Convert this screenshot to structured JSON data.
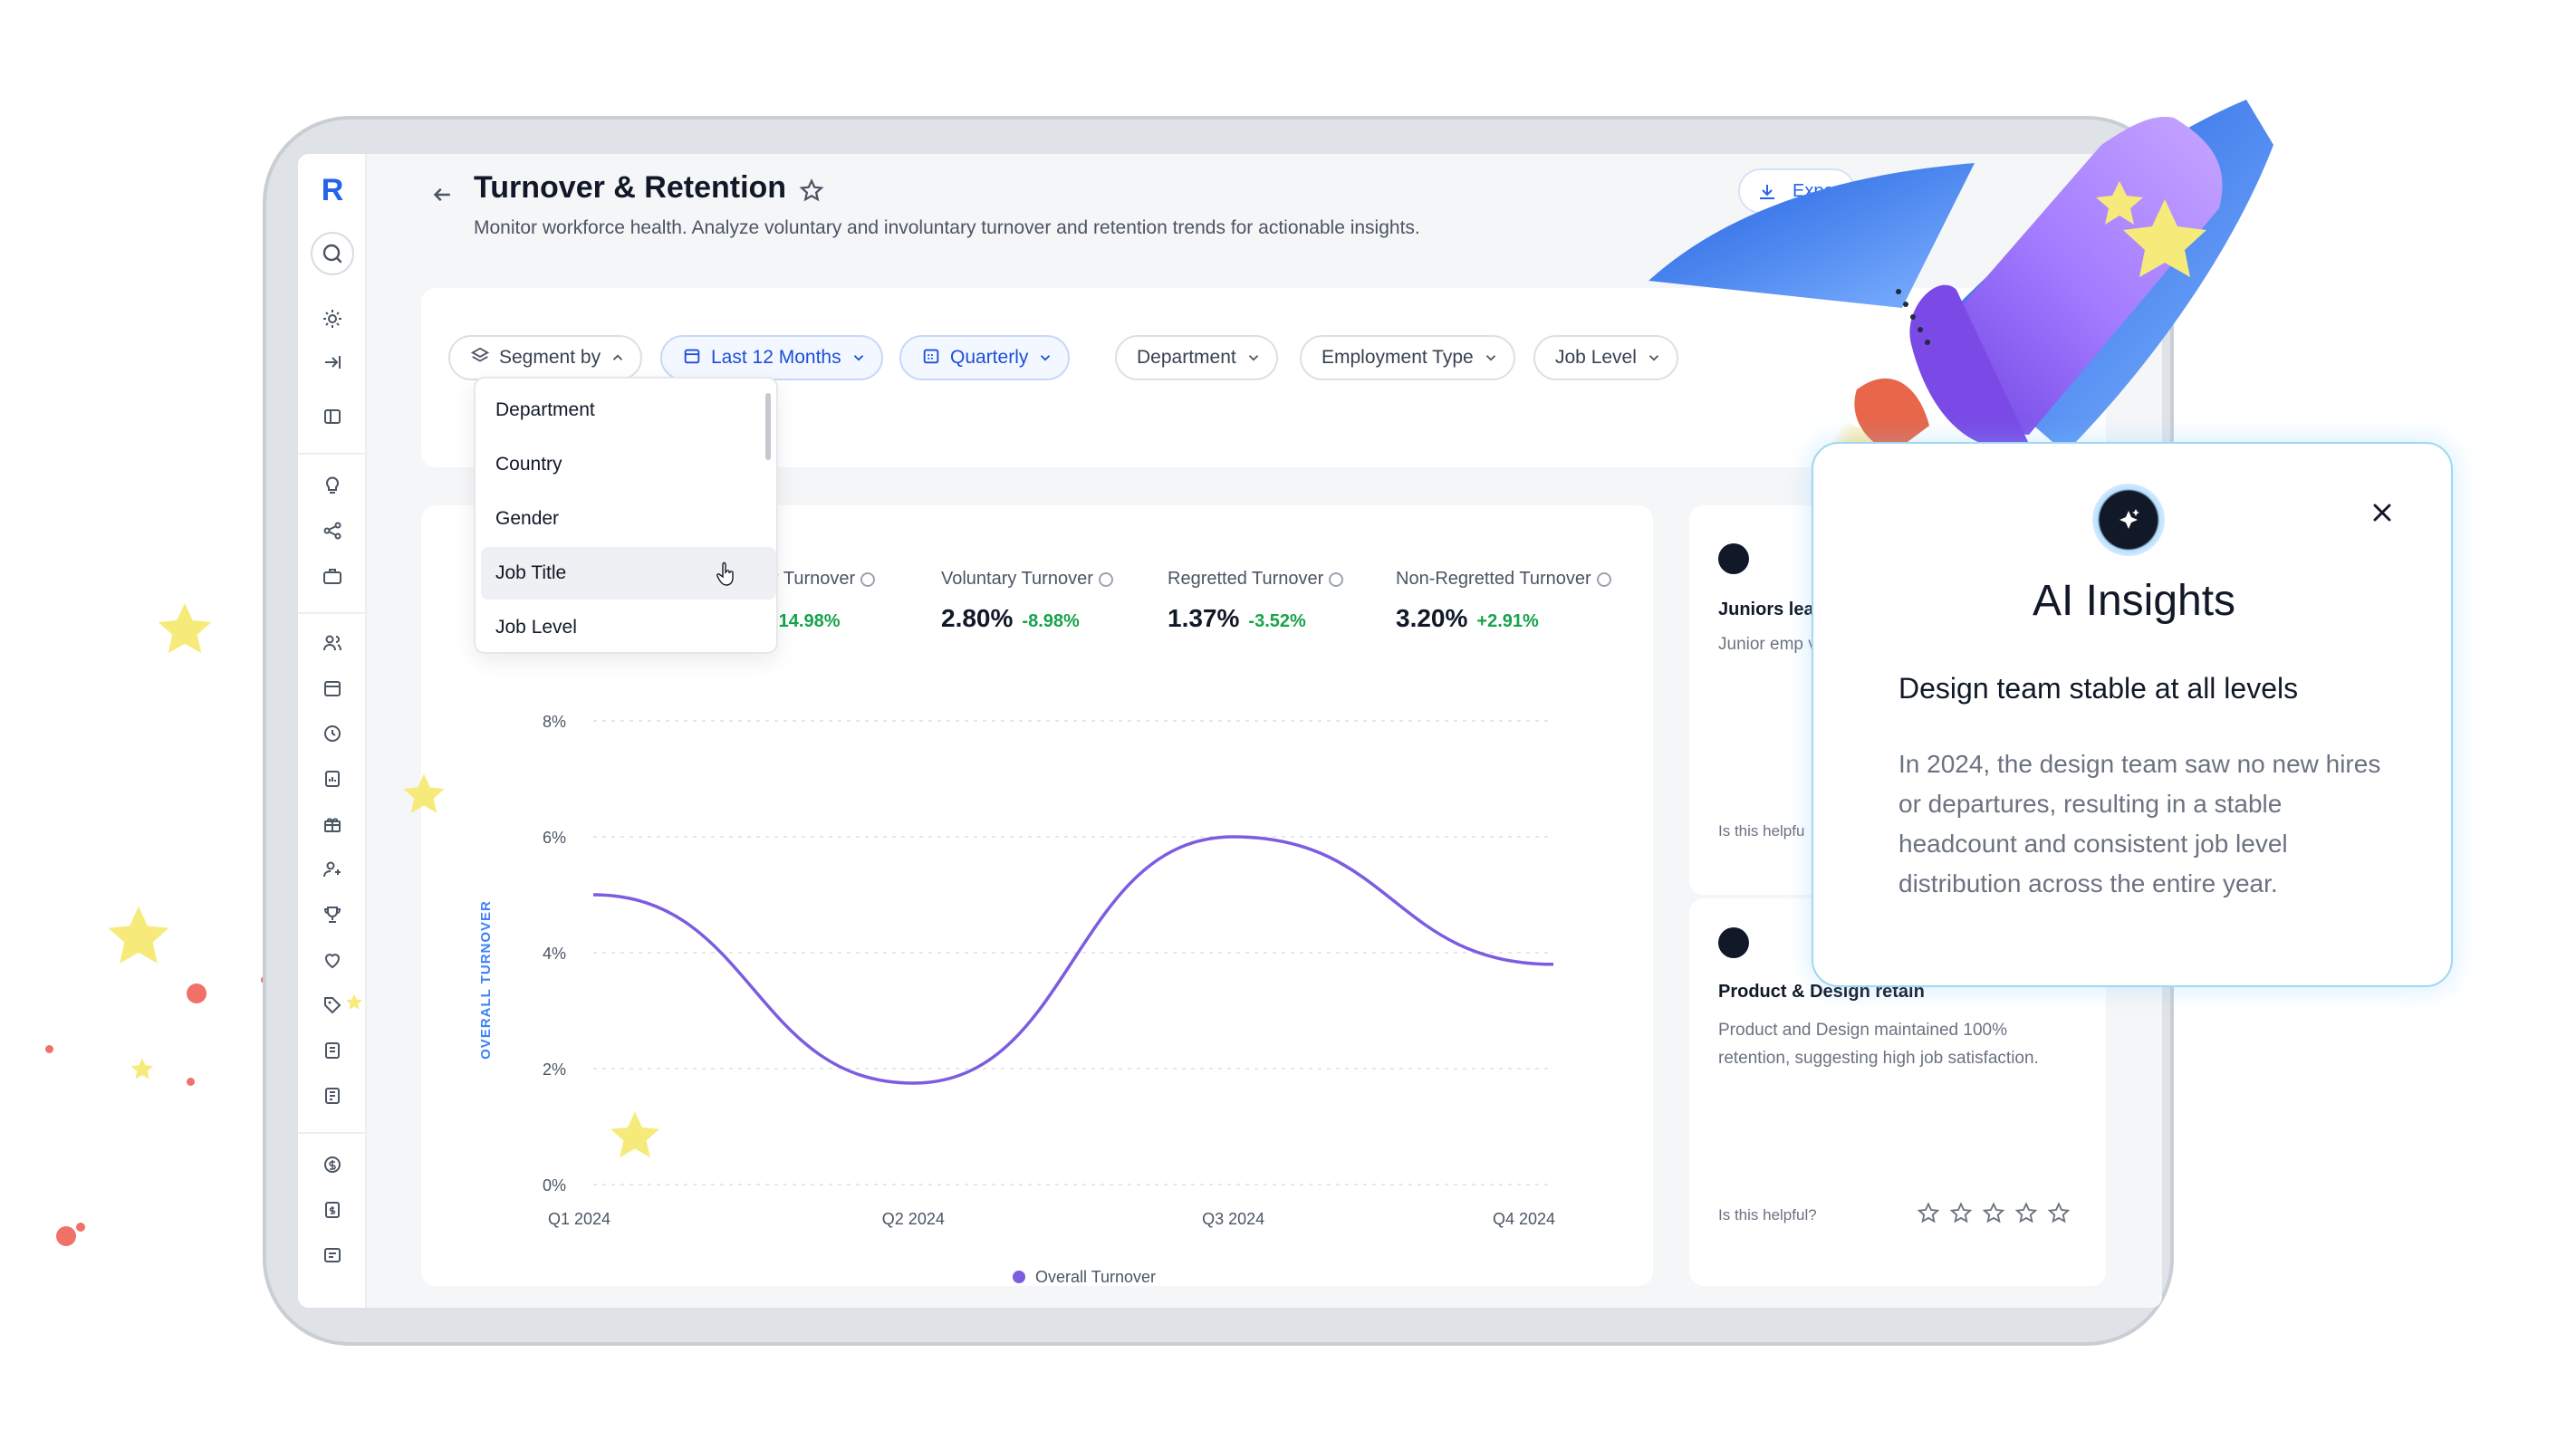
{
  "header": {
    "title": "Turnover & Retention",
    "description": "Monitor workforce health. Analyze voluntary and involuntary turnover and retention trends for actionable insights.",
    "export_label": "Export"
  },
  "filters": {
    "segment_by": "Segment by",
    "period": "Last 12 Months",
    "interval": "Quarterly",
    "department": "Department",
    "employment_type": "Employment Type",
    "job_level": "Job Level"
  },
  "segment_dropdown": {
    "options": [
      "Department",
      "Country",
      "Gender",
      "Job Title",
      "Job Level"
    ],
    "hovered": "Job Title"
  },
  "metrics": [
    {
      "label": "ry Turnover",
      "value": "",
      "delta": "-14.98%"
    },
    {
      "label": "Voluntary Turnover",
      "value": "2.80%",
      "delta": "-8.98%"
    },
    {
      "label": "Regretted Turnover",
      "value": "1.37%",
      "delta": "-3.52%"
    },
    {
      "label": "Non-Regretted Turnover",
      "value": "3.20%",
      "delta": "+2.91%"
    }
  ],
  "chart_data": {
    "type": "line",
    "x": [
      "Q1 2024",
      "Q2 2024",
      "Q3 2024",
      "Q4 2024"
    ],
    "series": [
      {
        "name": "Overall Turnover",
        "values": [
          5.0,
          1.75,
          6.0,
          3.8
        ]
      }
    ],
    "ylabel": "OVERALL TURNOVER",
    "yticks": [
      "0%",
      "2%",
      "4%",
      "6%",
      "8%"
    ],
    "ylim": [
      0,
      8
    ],
    "grid": true,
    "legend": "bottom-center",
    "color": "#7c5ce0"
  },
  "insight_cards": [
    {
      "title": "Juniors lea",
      "body": "Junior emp voluntary t growth cor",
      "help": "Is this helpfu"
    },
    {
      "title": "Product & Design retain",
      "body": "Product and Design maintained 100% retention, suggesting high job satisfaction.",
      "help": "Is this helpful?"
    }
  ],
  "ai_insights": {
    "title": "AI Insights",
    "headline": "Design team stable at all levels",
    "text": "In 2024, the design team saw no new hires or departures, resulting in a stable headcount and consistent job level distribution across the entire year."
  },
  "colors": {
    "accent": "#2563eb",
    "positive": "#16a34a",
    "line": "#7c5ce0",
    "popup_border": "#9fd8ef"
  }
}
